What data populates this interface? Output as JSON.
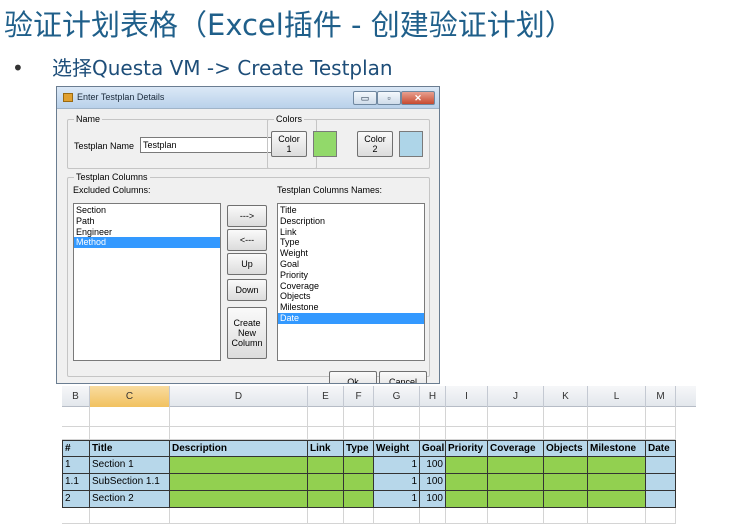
{
  "slide": {
    "title": "验证计划表格（Excel插件 - 创建验证计划）",
    "bullet": "选择Questa VM -> Create Testplan"
  },
  "dialog": {
    "title": "Enter Testplan Details",
    "window_buttons": {
      "minimize": "▭",
      "maximize": "▫",
      "close": "✕"
    },
    "name_group": {
      "legend": "Name",
      "field_label": "Testplan Name",
      "field_value": "Testplan"
    },
    "colors_group": {
      "legend": "Colors",
      "color1_label": "Color 1",
      "color1": "#92d96a",
      "color2_label": "Color 2",
      "color2": "#aed5e8"
    },
    "columns_group": {
      "legend": "Testplan Columns",
      "excluded_label": "Excluded Columns:",
      "names_label": "Testplan Columns Names:",
      "excluded": [
        "Section",
        "Path",
        "Engineer",
        "Method"
      ],
      "excluded_selected": "Method",
      "names": [
        "Title",
        "Description",
        "Link",
        "Type",
        "Weight",
        "Goal",
        "Priority",
        "Coverage",
        "Objects",
        "Milestone",
        "Date"
      ],
      "names_selected": "Date",
      "move_right": "--->",
      "move_left": "<---",
      "up": "Up",
      "down": "Down",
      "create_new_column": "Create New Column"
    },
    "ok": "Ok",
    "cancel": "Cancel"
  },
  "sheet": {
    "column_letters": [
      "B",
      "C",
      "D",
      "E",
      "F",
      "G",
      "H",
      "I",
      "J",
      "K",
      "L",
      "M"
    ],
    "selected_column": "C",
    "header": [
      "#",
      "Title",
      "Description",
      "Link",
      "Type",
      "Weight",
      "Goal",
      "Priority",
      "Coverage",
      "Objects",
      "Milestone",
      "Date"
    ],
    "rows": [
      [
        "1",
        "Section 1",
        "",
        "",
        "",
        "1",
        "100",
        "",
        "",
        "",
        "",
        ""
      ],
      [
        "1.1",
        "SubSection 1.1",
        "",
        "",
        "",
        "1",
        "100",
        "",
        "",
        "",
        "",
        ""
      ],
      [
        "2",
        "Section 2",
        "",
        "",
        "",
        "1",
        "100",
        "",
        "",
        "",
        "",
        ""
      ]
    ],
    "colors": {
      "header_fill": "#b7d7ea",
      "green_fill": "#92d050"
    }
  }
}
